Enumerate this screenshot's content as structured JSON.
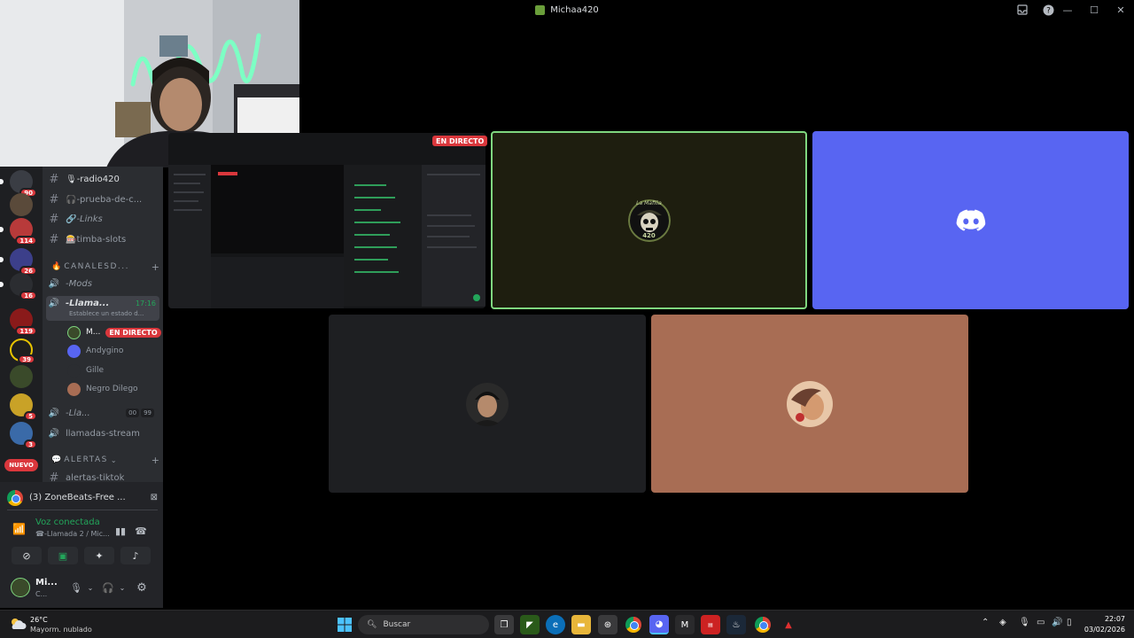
{
  "window": {
    "title": "Michaa420",
    "controls": {
      "minimize": "—",
      "maximize": "☐",
      "close": "✕"
    },
    "toolbar_icons": [
      "inbox-icon",
      "help-icon"
    ]
  },
  "server_rail": {
    "badges": [
      "90",
      "114",
      "26",
      "16",
      "119",
      "39",
      "5",
      "3"
    ],
    "new_label": "NUEVO"
  },
  "channels": {
    "text_channels": [
      {
        "name": "-radio420",
        "prefix": "🎙"
      },
      {
        "name": "-prueba-de-c...",
        "prefix": "🎧"
      },
      {
        "name": "-Links",
        "prefix": "🔗"
      },
      {
        "name": "timba-slots",
        "prefix": "🎰"
      }
    ],
    "category_1": "CANALESD...",
    "voice_mods": "-Mods",
    "voice_active": {
      "name": "-Llama...",
      "time": "17:16",
      "status": "Establece un estado d..."
    },
    "voice_users": [
      {
        "name": "M...",
        "live": "EN DIRECTO"
      },
      {
        "name": "Andygino"
      },
      {
        "name": "Gille"
      },
      {
        "name": "Negro Dilego"
      }
    ],
    "voice_other": {
      "name": "-Lla...",
      "count_a": "00",
      "count_b": "99"
    },
    "stream_channel": "llamadas-stream",
    "category_2": "ALERTAS",
    "partial_channel": "alertas-tiktok"
  },
  "panel": {
    "stream_title": "(3) ZoneBeats-Free ...",
    "voice_connected": "Voz conectada",
    "voice_location": "☎-Llamada 2 / Mic...",
    "me_name": "Mi...",
    "me_status": "C..."
  },
  "tiles": {
    "live_badge": "EN DIRECTO",
    "mafia_logo_line1": "La Mafilia",
    "mafia_logo_line2": "420"
  },
  "taskbar": {
    "weather_temp": "26°C",
    "weather_cond": "Mayorm. nublado",
    "search_placeholder": "Buscar",
    "time": "22:07",
    "date": "03/02/2026"
  },
  "colors": {
    "discord_blurple": "#5865f2",
    "live_red": "#da373c",
    "voice_green": "#23a55a",
    "mafia_border": "#7fd67f",
    "tan_tile": "#a86d54"
  }
}
